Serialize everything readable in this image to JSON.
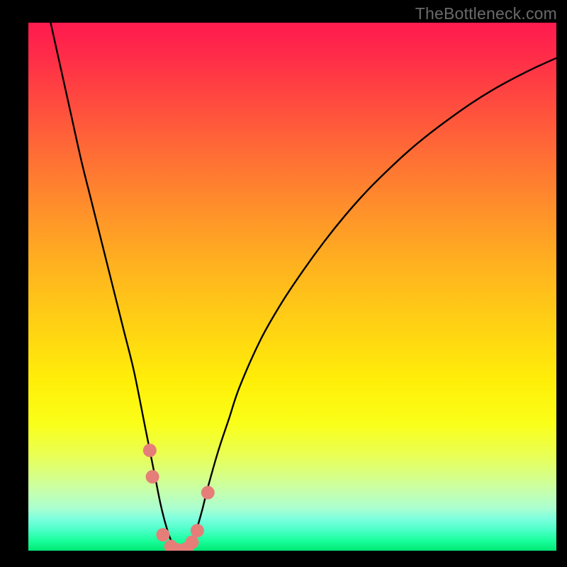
{
  "watermark": "TheBottleneck.com",
  "colors": {
    "frame": "#000000",
    "curve": "#000000",
    "marker_fill": "#e57e78",
    "marker_stroke": "#d26560",
    "gradient_top": "#ff1a4f",
    "gradient_bottom": "#00e874"
  },
  "chart_data": {
    "type": "line",
    "title": "",
    "xlabel": "",
    "ylabel": "",
    "xlim": [
      0,
      100
    ],
    "ylim": [
      0,
      100
    ],
    "x": [
      0,
      2,
      4,
      6,
      8,
      10,
      12,
      14,
      16,
      18,
      20,
      22,
      23,
      24,
      25,
      26,
      27,
      28,
      29,
      30,
      31,
      32,
      33,
      34,
      36,
      38,
      40,
      44,
      48,
      52,
      56,
      60,
      64,
      68,
      72,
      76,
      80,
      84,
      88,
      92,
      96,
      100
    ],
    "series": [
      {
        "name": "bottleneck-curve",
        "values": [
          120,
          110,
          101,
          92,
          83,
          74,
          66,
          58,
          50,
          42,
          34,
          24,
          19,
          14,
          9,
          5,
          2,
          0.6,
          0,
          0.4,
          2,
          4.5,
          8,
          12,
          19,
          25,
          31,
          40,
          47,
          53,
          58.5,
          63.5,
          68,
          72,
          75.7,
          79,
          82,
          84.8,
          87.3,
          89.5,
          91.5,
          93.3
        ]
      }
    ],
    "markers": [
      {
        "x": 23.0,
        "y": 19.0
      },
      {
        "x": 23.5,
        "y": 14.0
      },
      {
        "x": 25.5,
        "y": 3.0
      },
      {
        "x": 27.0,
        "y": 0.8
      },
      {
        "x": 28.0,
        "y": 0.2
      },
      {
        "x": 29.0,
        "y": 0.0
      },
      {
        "x": 30.0,
        "y": 0.4
      },
      {
        "x": 31.0,
        "y": 1.6
      },
      {
        "x": 32.0,
        "y": 3.8
      },
      {
        "x": 34.0,
        "y": 11.0
      }
    ]
  }
}
